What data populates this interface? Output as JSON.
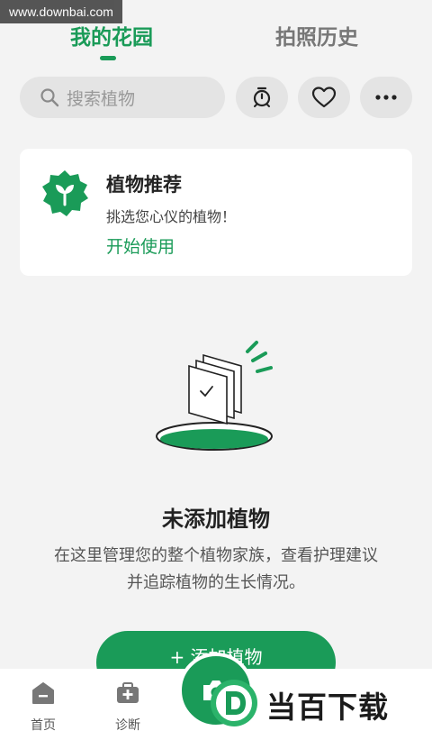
{
  "watermark": {
    "text": "www.downbai.com"
  },
  "tabs": [
    {
      "label": "我的花园",
      "active": true
    },
    {
      "label": "拍照历史",
      "active": false
    }
  ],
  "search": {
    "placeholder": "搜索植物",
    "icon": "search-icon"
  },
  "toolbar": {
    "timer_icon": "timer-icon",
    "favorites_icon": "heart-icon",
    "more_icon": "more-icon"
  },
  "recommend_card": {
    "title": "植物推荐",
    "subtitle": "挑选您心仪的植物！",
    "action_label": "开始使用",
    "icon": "sprout-badge-icon"
  },
  "empty_state": {
    "title": "未添加植物",
    "description": "在这里管理您的整个植物家族，查看护理建议并追踪植物的生长情况。"
  },
  "add_button": {
    "label": "+ 添加植物"
  },
  "bottom_nav": {
    "items": [
      {
        "label": "首页",
        "icon": "home-icon"
      },
      {
        "label": "诊断",
        "icon": "diagnosis-icon"
      }
    ],
    "camera_icon": "camera-icon"
  },
  "brand_watermark": {
    "text": "当百下载",
    "logo_letter": "D"
  },
  "colors": {
    "accent": "#1a9b58",
    "background": "#f3f3f3",
    "card": "#ffffff"
  }
}
